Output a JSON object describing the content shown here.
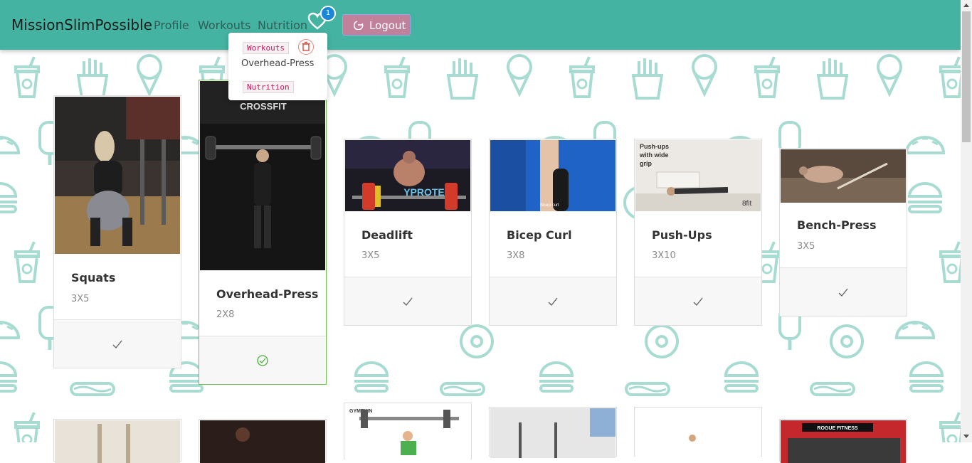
{
  "app": {
    "brand": "MissionSlimPossible"
  },
  "nav": {
    "links": [
      {
        "label": "Profile"
      },
      {
        "label": "Workouts"
      },
      {
        "label": "Nutrition"
      }
    ],
    "favorites_count": "1",
    "logout_label": "Logout"
  },
  "dropdown": {
    "workouts_tag": "Workouts",
    "workouts_item": "Overhead-Press",
    "nutrition_tag": "Nutrition"
  },
  "cards": [
    {
      "title": "Squats",
      "reps": "3X5",
      "completed": false
    },
    {
      "title": "Overhead-Press",
      "reps": "2X8",
      "completed": true
    },
    {
      "title": "Deadlift",
      "reps": "3X5",
      "completed": false
    },
    {
      "title": "Bicep Curl",
      "reps": "3X8",
      "completed": false
    },
    {
      "title": "Push-Ups",
      "reps": "3X10",
      "completed": false
    },
    {
      "title": "Bench-Press",
      "reps": "3X5",
      "completed": false
    }
  ],
  "image_captions": {
    "overhead_logo": "CROSSFIT",
    "deadlift_banner": "YPROTEIN",
    "bicep_caption": "Bicep curl",
    "pushups_caption": "Push-ups with wide grip",
    "pushups_logo": "8fit",
    "second_row_logo_a": "GYMEXIN",
    "second_row_logo_b": "ROGUE FITNESS"
  },
  "colors": {
    "navbar": "#45b3a1",
    "logout": "#c2819a",
    "badge": "#1b86d8",
    "active_border": "#6cc24a",
    "pattern": "#a8dcd2"
  }
}
